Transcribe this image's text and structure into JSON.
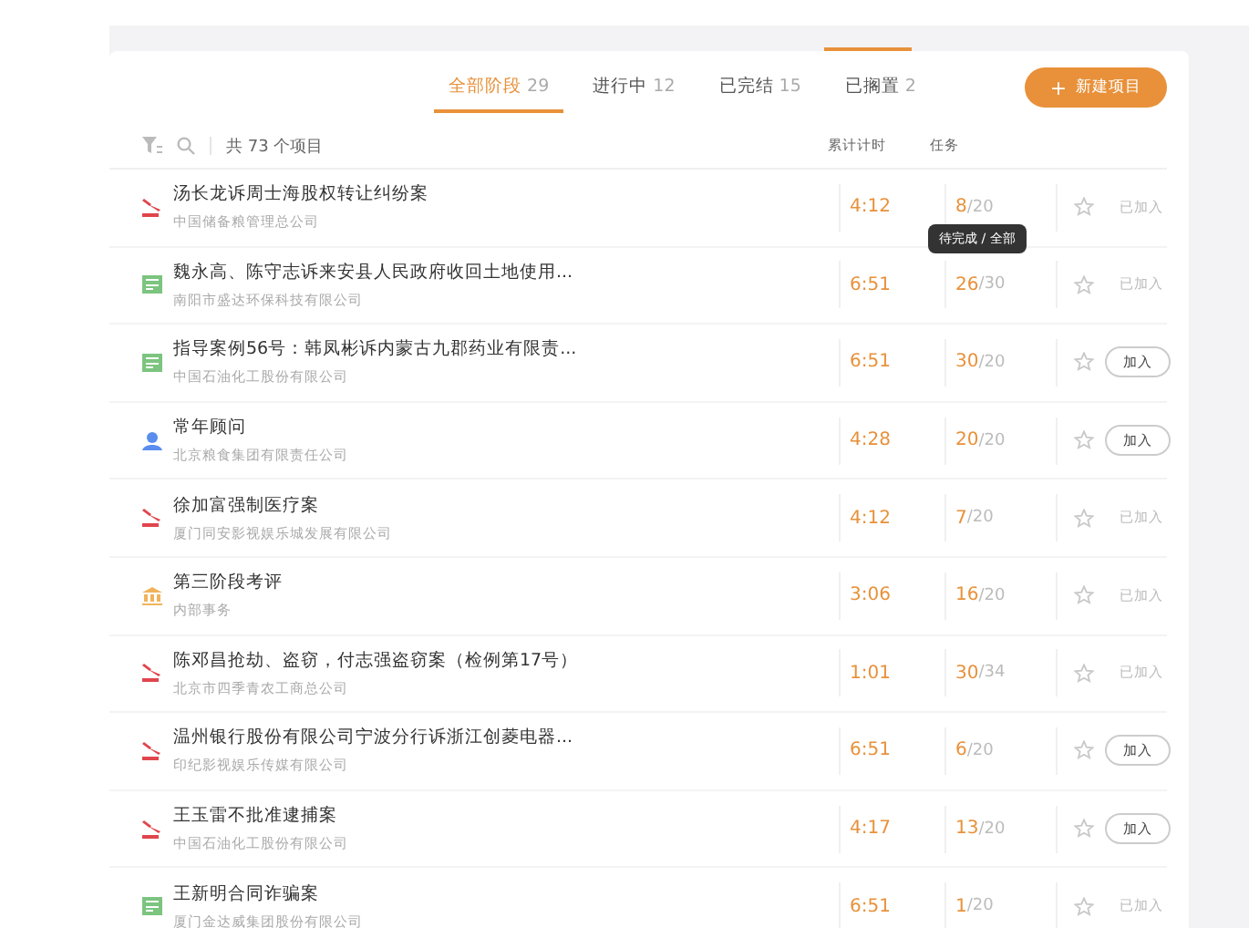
{
  "stage_tabs": [
    {
      "label": "全部阶段",
      "count": "29",
      "selected": true
    },
    {
      "label": "进行中",
      "count": "12",
      "selected": false
    },
    {
      "label": "已完结",
      "count": "15",
      "selected": false
    },
    {
      "label": "已搁置",
      "count": "2",
      "selected": false
    }
  ],
  "new_button": {
    "icon": "+",
    "label": "新建项目"
  },
  "toolbar": {
    "summary": "共 73 个项目"
  },
  "columns": {
    "time": "累计计时",
    "tasks": "任务"
  },
  "rows": [
    {
      "kind": "gavel",
      "title": "汤长龙诉周士海股权转让纠纷案",
      "client": "中国储备粮管理总公司",
      "time": "4:12",
      "done": "8",
      "total": "/20",
      "joined": true,
      "join_label": "已加入"
    },
    {
      "kind": "ledger",
      "title": "魏永高、陈守志诉来安县人民政府收回土地使用...",
      "client": "南阳市盛达环保科技有限公司",
      "time": "6:51",
      "done": "26",
      "total": "/30",
      "tooltip": "待完成 / 全部",
      "joined": true,
      "join_label": "已加入"
    },
    {
      "kind": "ledger",
      "title": "指导案例56号：韩凤彬诉内蒙古九郡药业有限责...",
      "client": "中国石油化工股份有限公司",
      "time": "6:51",
      "done": "30",
      "total": "/20",
      "joined": false,
      "join_label": "加入"
    },
    {
      "kind": "person",
      "title": "常年顾问",
      "client": "北京粮食集团有限责任公司",
      "time": "4:28",
      "done": "20",
      "total": "/20",
      "joined": false,
      "join_label": "加入"
    },
    {
      "kind": "gavel",
      "title": "徐加富强制医疗案",
      "client": "厦门同安影视娱乐城发展有限公司",
      "time": "4:12",
      "done": "7",
      "total": "/20",
      "joined": true,
      "join_label": "已加入"
    },
    {
      "kind": "bank",
      "title": "第三阶段考评",
      "client": "内部事务",
      "time": "3:06",
      "done": "16",
      "total": "/20",
      "joined": true,
      "join_label": "已加入"
    },
    {
      "kind": "gavel",
      "title": "陈邓昌抢劫、盗窃，付志强盗窃案（检例第17号）",
      "client": "北京市四季青农工商总公司",
      "time": "1:01",
      "done": "30",
      "total": "/34",
      "joined": true,
      "join_label": "已加入"
    },
    {
      "kind": "gavel",
      "title": "温州银行股份有限公司宁波分行诉浙江创菱电器...",
      "client": "印纪影视娱乐传媒有限公司",
      "time": "6:51",
      "done": "6",
      "total": "/20",
      "joined": false,
      "join_label": "加入"
    },
    {
      "kind": "gavel",
      "title": "王玉雷不批准逮捕案",
      "client": "中国石油化工股份有限公司",
      "time": "4:17",
      "done": "13",
      "total": "/20",
      "joined": false,
      "join_label": "加入"
    },
    {
      "kind": "ledger",
      "title": "王新明合同诈骗案",
      "client": "厦门金达威集团股份有限公司",
      "time": "6:51",
      "done": "1",
      "total": "/20",
      "joined": true,
      "join_label": "已加入"
    }
  ]
}
